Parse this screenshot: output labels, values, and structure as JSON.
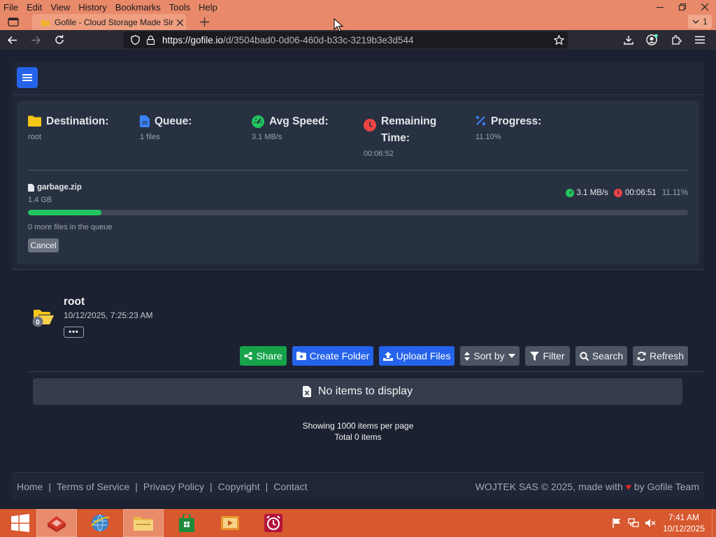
{
  "browser": {
    "menu": [
      "File",
      "Edit",
      "View",
      "History",
      "Bookmarks",
      "Tools",
      "Help"
    ],
    "tab_title": "Gofile - Cloud Storage Made Sir",
    "tab_count": "1",
    "url_host": "https://gofile.io",
    "url_path": "/d/3504bad0-0d06-460d-b33c-3219b3e3d544"
  },
  "upload": {
    "destination": {
      "label": "Destination:",
      "value": "root"
    },
    "queue": {
      "label": "Queue:",
      "value": "1 files"
    },
    "avg_speed": {
      "label": "Avg Speed:",
      "value": "3.1 MB/s"
    },
    "remaining": {
      "label": "Remaining Time:",
      "value": "00:06:52"
    },
    "progress": {
      "label": "Progress:",
      "value": "11.10%"
    },
    "file": {
      "name": "garbage.zip",
      "size": "1.4 GB",
      "speed": "3.1 MB/s",
      "time_left": "00:06:51",
      "percent": "11.11%",
      "fill_fraction": 0.1111
    },
    "queue_note": "0 more files in the queue",
    "cancel_label": "Cancel"
  },
  "folder": {
    "name": "root",
    "date": "10/12/2025, 7:25:23 AM",
    "badge": "0",
    "more_label": "•••"
  },
  "toolbar": {
    "share": "Share",
    "create_folder": "Create Folder",
    "upload_files": "Upload Files",
    "sort_by": "Sort by",
    "filter": "Filter",
    "search": "Search",
    "refresh": "Refresh"
  },
  "empty_message": "No items to display",
  "paging": {
    "per_page": "Showing 1000 items per page",
    "total": "Total 0 items"
  },
  "footer": {
    "links": [
      "Home",
      "Terms of Service",
      "Privacy Policy",
      "Copyright",
      "Contact"
    ],
    "copyright_prefix": "WOJTEK SAS © 2025, made with",
    "copyright_suffix": "by Gofile Team"
  },
  "taskbar": {
    "time": "7:41 AM",
    "date": "10/12/2025"
  },
  "colors": {
    "accent_blue": "#2563eb",
    "accent_green": "#16a34a",
    "danger_red": "#dc2626",
    "page_bg": "#1b2130",
    "browser_chrome": "#e8896a"
  }
}
